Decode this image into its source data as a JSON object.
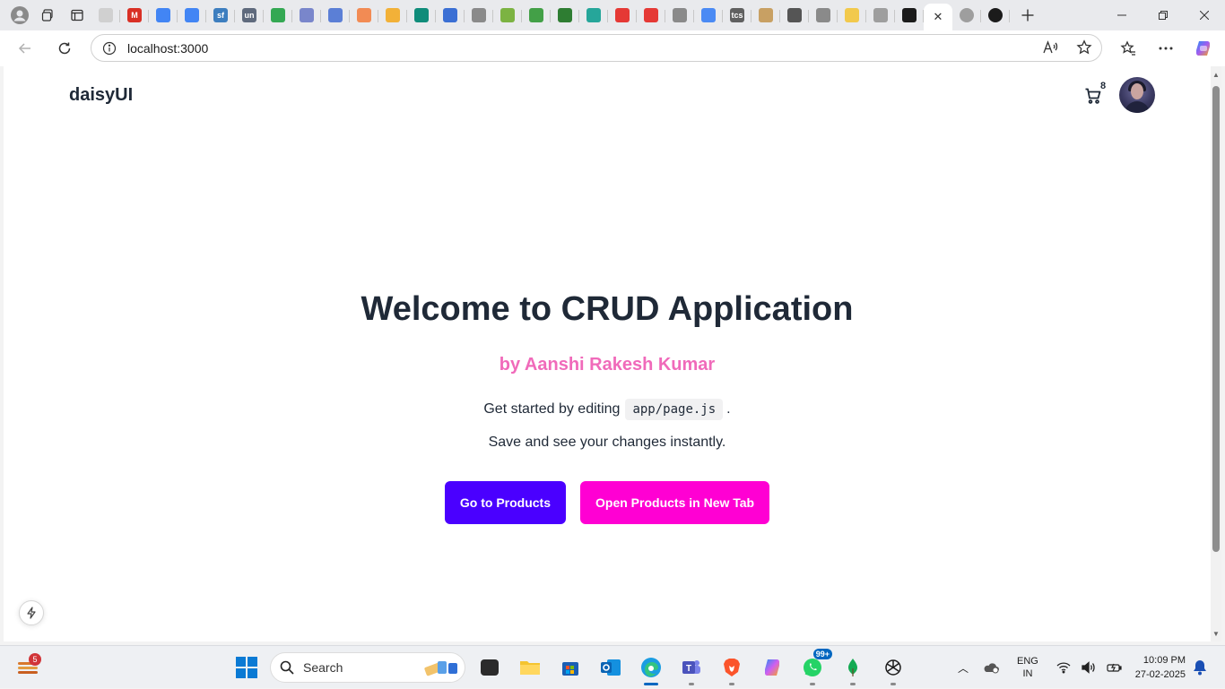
{
  "browser": {
    "url": "localhost:3000",
    "active_tab_close": "✕",
    "tab_favicons": [
      {
        "name": "tab-favicon-1",
        "color": "#d0d0d0",
        "text": ""
      },
      {
        "name": "tab-favicon-2",
        "color": "#d93025",
        "text": "M"
      },
      {
        "name": "tab-favicon-3",
        "color": "#4285f4",
        "text": ""
      },
      {
        "name": "tab-favicon-4",
        "color": "#4285f4",
        "text": ""
      },
      {
        "name": "tab-favicon-5",
        "color": "#3d7ebf",
        "text": "sf"
      },
      {
        "name": "tab-favicon-6",
        "color": "#5f6a7d",
        "text": "un"
      },
      {
        "name": "tab-favicon-7",
        "color": "#34a853",
        "text": ""
      },
      {
        "name": "tab-favicon-8",
        "color": "#7986cb",
        "text": ""
      },
      {
        "name": "tab-favicon-9",
        "color": "#5b7fd6",
        "text": ""
      },
      {
        "name": "tab-favicon-10",
        "color": "#f28b54",
        "text": ""
      },
      {
        "name": "tab-favicon-11",
        "color": "#f2b138",
        "text": ""
      },
      {
        "name": "tab-favicon-12",
        "color": "#0f8c7a",
        "text": ""
      },
      {
        "name": "tab-favicon-13",
        "color": "#3b6fd4",
        "text": ""
      },
      {
        "name": "tab-favicon-14",
        "color": "#8a8a8a",
        "text": ""
      },
      {
        "name": "tab-favicon-15",
        "color": "#7cb342",
        "text": ""
      },
      {
        "name": "tab-favicon-16",
        "color": "#43a047",
        "text": ""
      },
      {
        "name": "tab-favicon-17",
        "color": "#2e7d32",
        "text": ""
      },
      {
        "name": "tab-favicon-18",
        "color": "#26a69a",
        "text": ""
      },
      {
        "name": "tab-favicon-19",
        "color": "#e53935",
        "text": ""
      },
      {
        "name": "tab-favicon-20",
        "color": "#e53935",
        "text": ""
      },
      {
        "name": "tab-favicon-21",
        "color": "#8a8a8a",
        "text": ""
      },
      {
        "name": "tab-favicon-22",
        "color": "#4a8af4",
        "text": ""
      },
      {
        "name": "tab-favicon-23",
        "color": "#606060",
        "text": "tcs"
      },
      {
        "name": "tab-favicon-24",
        "color": "#c8a063",
        "text": ""
      },
      {
        "name": "tab-favicon-25",
        "color": "#555555",
        "text": ""
      },
      {
        "name": "tab-favicon-26",
        "color": "#8a8a8a",
        "text": ""
      },
      {
        "name": "tab-favicon-27",
        "color": "#f2c94c",
        "text": ""
      },
      {
        "name": "tab-favicon-28",
        "color": "#9e9e9e",
        "text": ""
      },
      {
        "name": "tab-favicon-29",
        "color": "#1b1b1b",
        "text": ""
      }
    ]
  },
  "navbar": {
    "brand": "daisyUI",
    "cart_count": "8"
  },
  "hero": {
    "title": "Welcome to CRUD Application",
    "subtitle": "by Aanshi Rakesh Kumar",
    "get_started_prefix": "Get started by editing",
    "code": "app/page.js",
    "get_started_suffix": ".",
    "save_line": "Save and see your changes instantly.",
    "primary_button": "Go to Products",
    "secondary_button": "Open Products in New Tab"
  },
  "colors": {
    "primary": "#4a00ff",
    "secondary": "#ff00d3",
    "subtitle": "#f06aba",
    "text": "#1f2937"
  },
  "taskbar": {
    "widget_badge": "5",
    "search_label": "Search",
    "whatsapp_badge": "99+",
    "lang_line1": "ENG",
    "lang_line2": "IN",
    "time": "10:09 PM",
    "date": "27-02-2025"
  }
}
